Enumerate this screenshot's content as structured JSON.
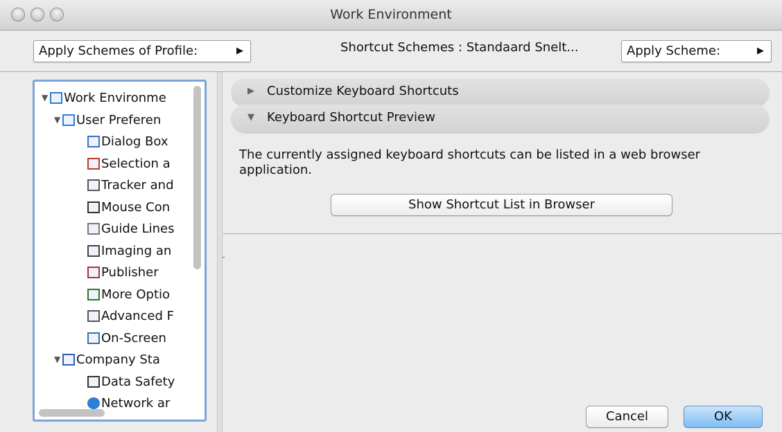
{
  "window": {
    "title": "Work Environment"
  },
  "toolbar": {
    "apply_profile": "Apply Schemes of Profile:",
    "scheme_label": "Shortcut Schemes : Standaard Snelt...",
    "apply_scheme": "Apply Scheme:"
  },
  "tree": {
    "items": [
      {
        "label": "Work Environme",
        "icon": "work-environment-icon"
      },
      {
        "label": "User Preferen",
        "icon": "user-preferences-icon"
      },
      {
        "label": "Dialog Box",
        "icon": "dialog-boxes-icon"
      },
      {
        "label": "Selection a",
        "icon": "selection-icon"
      },
      {
        "label": "Tracker and",
        "icon": "tracker-icon"
      },
      {
        "label": "Mouse Con",
        "icon": "mouse-icon"
      },
      {
        "label": "Guide Lines",
        "icon": "guide-lines-icon"
      },
      {
        "label": "Imaging an",
        "icon": "imaging-icon"
      },
      {
        "label": "Publisher",
        "icon": "publisher-icon"
      },
      {
        "label": "More Optio",
        "icon": "more-options-icon"
      },
      {
        "label": "Advanced F",
        "icon": "advanced-icon"
      },
      {
        "label": "On-Screen",
        "icon": "on-screen-icon"
      },
      {
        "label": "Company Sta",
        "icon": "company-standards-icon"
      },
      {
        "label": "Data Safety",
        "icon": "data-safety-icon"
      },
      {
        "label": "Network ar",
        "icon": "network-icon"
      }
    ]
  },
  "sections": {
    "customize": "Customize Keyboard Shortcuts",
    "preview": "Keyboard Shortcut Preview"
  },
  "preview": {
    "description": "The currently assigned keyboard shortcuts can be listed in a web browser application.",
    "button": "Show Shortcut List in Browser"
  },
  "footer": {
    "cancel": "Cancel",
    "ok": "OK"
  }
}
